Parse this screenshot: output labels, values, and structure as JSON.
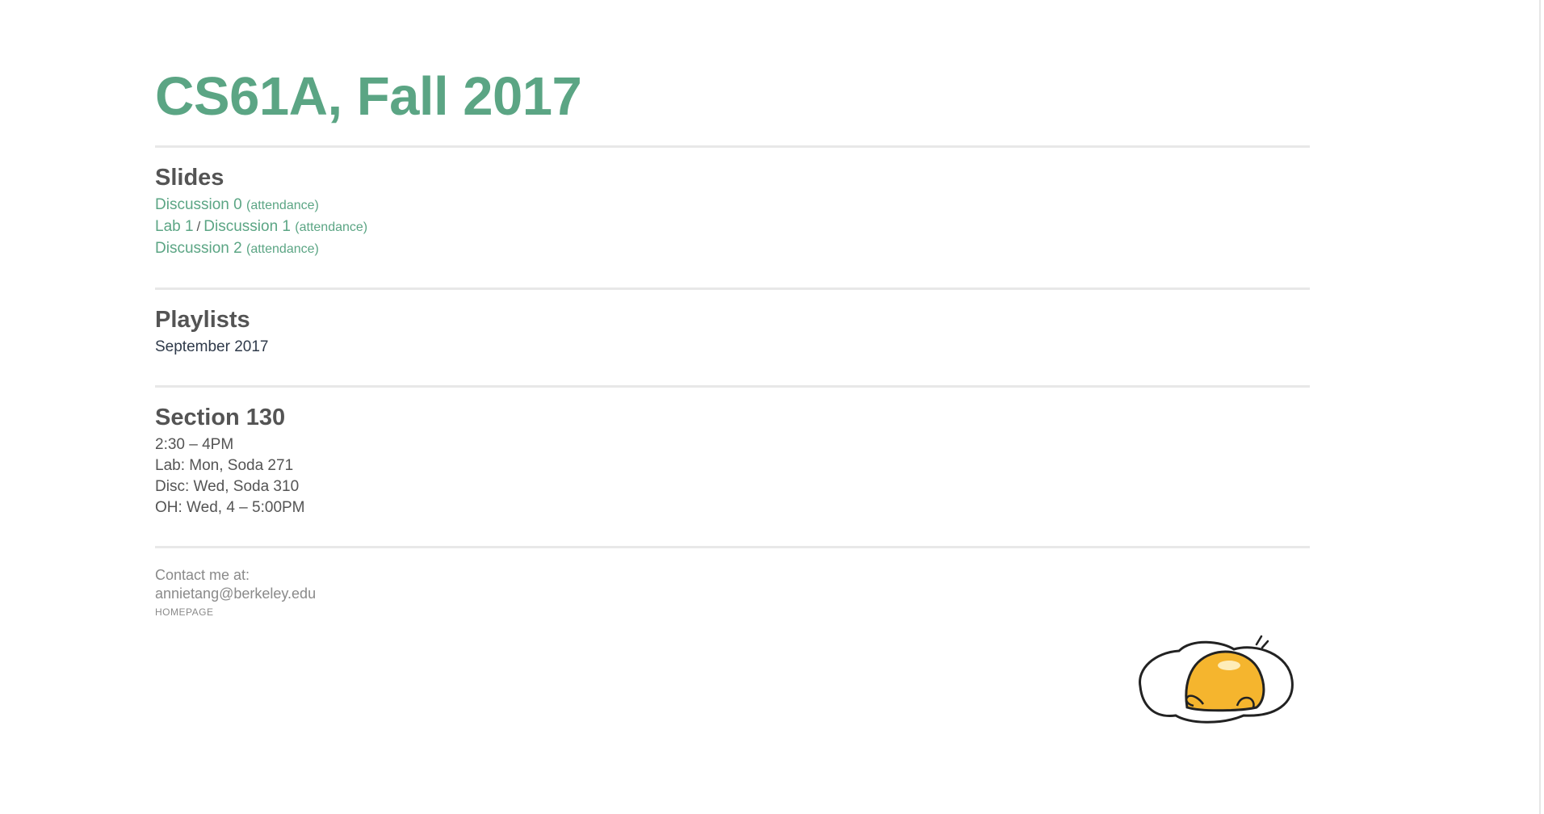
{
  "title": "CS61A, Fall 2017",
  "slides": {
    "heading": "Slides",
    "items": [
      {
        "link": "Discussion 0",
        "attendance": "(attendance)"
      },
      {
        "link_a": "Lab 1",
        "separator": "/",
        "link_b": "Discussion 1",
        "attendance": "(attendance)"
      },
      {
        "link": "Discussion 2",
        "attendance": "(attendance)"
      }
    ]
  },
  "playlists": {
    "heading": "Playlists",
    "items": [
      "September 2017"
    ]
  },
  "section": {
    "heading": "Section 130",
    "lines": [
      "2:30 – 4PM",
      "Lab: Mon, Soda 271",
      "Disc: Wed, Soda 310",
      "OH: Wed, 4 – 5:00PM"
    ]
  },
  "contact": {
    "label": "Contact me at:",
    "email": "annietang@berkeley.edu",
    "homepage": "HOMEPAGE"
  },
  "mascot": {
    "icon": "egg-mascot-icon",
    "colors": {
      "yolk": "#f5b52e",
      "outline": "#222222",
      "white": "#ffffff"
    }
  },
  "colors": {
    "accent": "#5ba584",
    "heading": "#545454",
    "muted": "#8a8a8a",
    "rule": "#e8e8e8"
  }
}
